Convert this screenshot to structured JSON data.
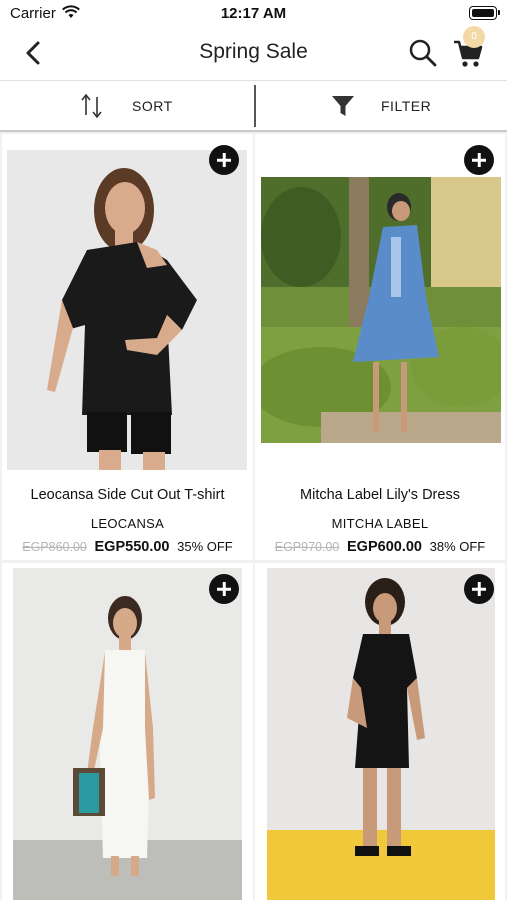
{
  "status_bar": {
    "carrier": "Carrier",
    "time": "12:17 AM"
  },
  "nav": {
    "title": "Spring Sale",
    "cart_count": "0"
  },
  "toolbar": {
    "sort_label": "SORT",
    "filter_label": "FILTER"
  },
  "products": [
    {
      "name": "Leocansa Side Cut Out T-shirt",
      "brand": "LEOCANSA",
      "old_price": "EGP860.00",
      "price": "EGP550.00",
      "discount": "35% OFF"
    },
    {
      "name": "Mitcha Label Lily's Dress",
      "brand": "MITCHA LABEL",
      "old_price": "EGP970.00",
      "price": "EGP600.00",
      "discount": "38% OFF"
    },
    {
      "name": "",
      "brand": "",
      "old_price": "",
      "price": "",
      "discount": ""
    },
    {
      "name": "",
      "brand": "",
      "old_price": "",
      "price": "",
      "discount": ""
    }
  ],
  "colors": {
    "accent": "#111111",
    "badge": "#f3d9a6",
    "old_price": "#b5b5b5"
  }
}
